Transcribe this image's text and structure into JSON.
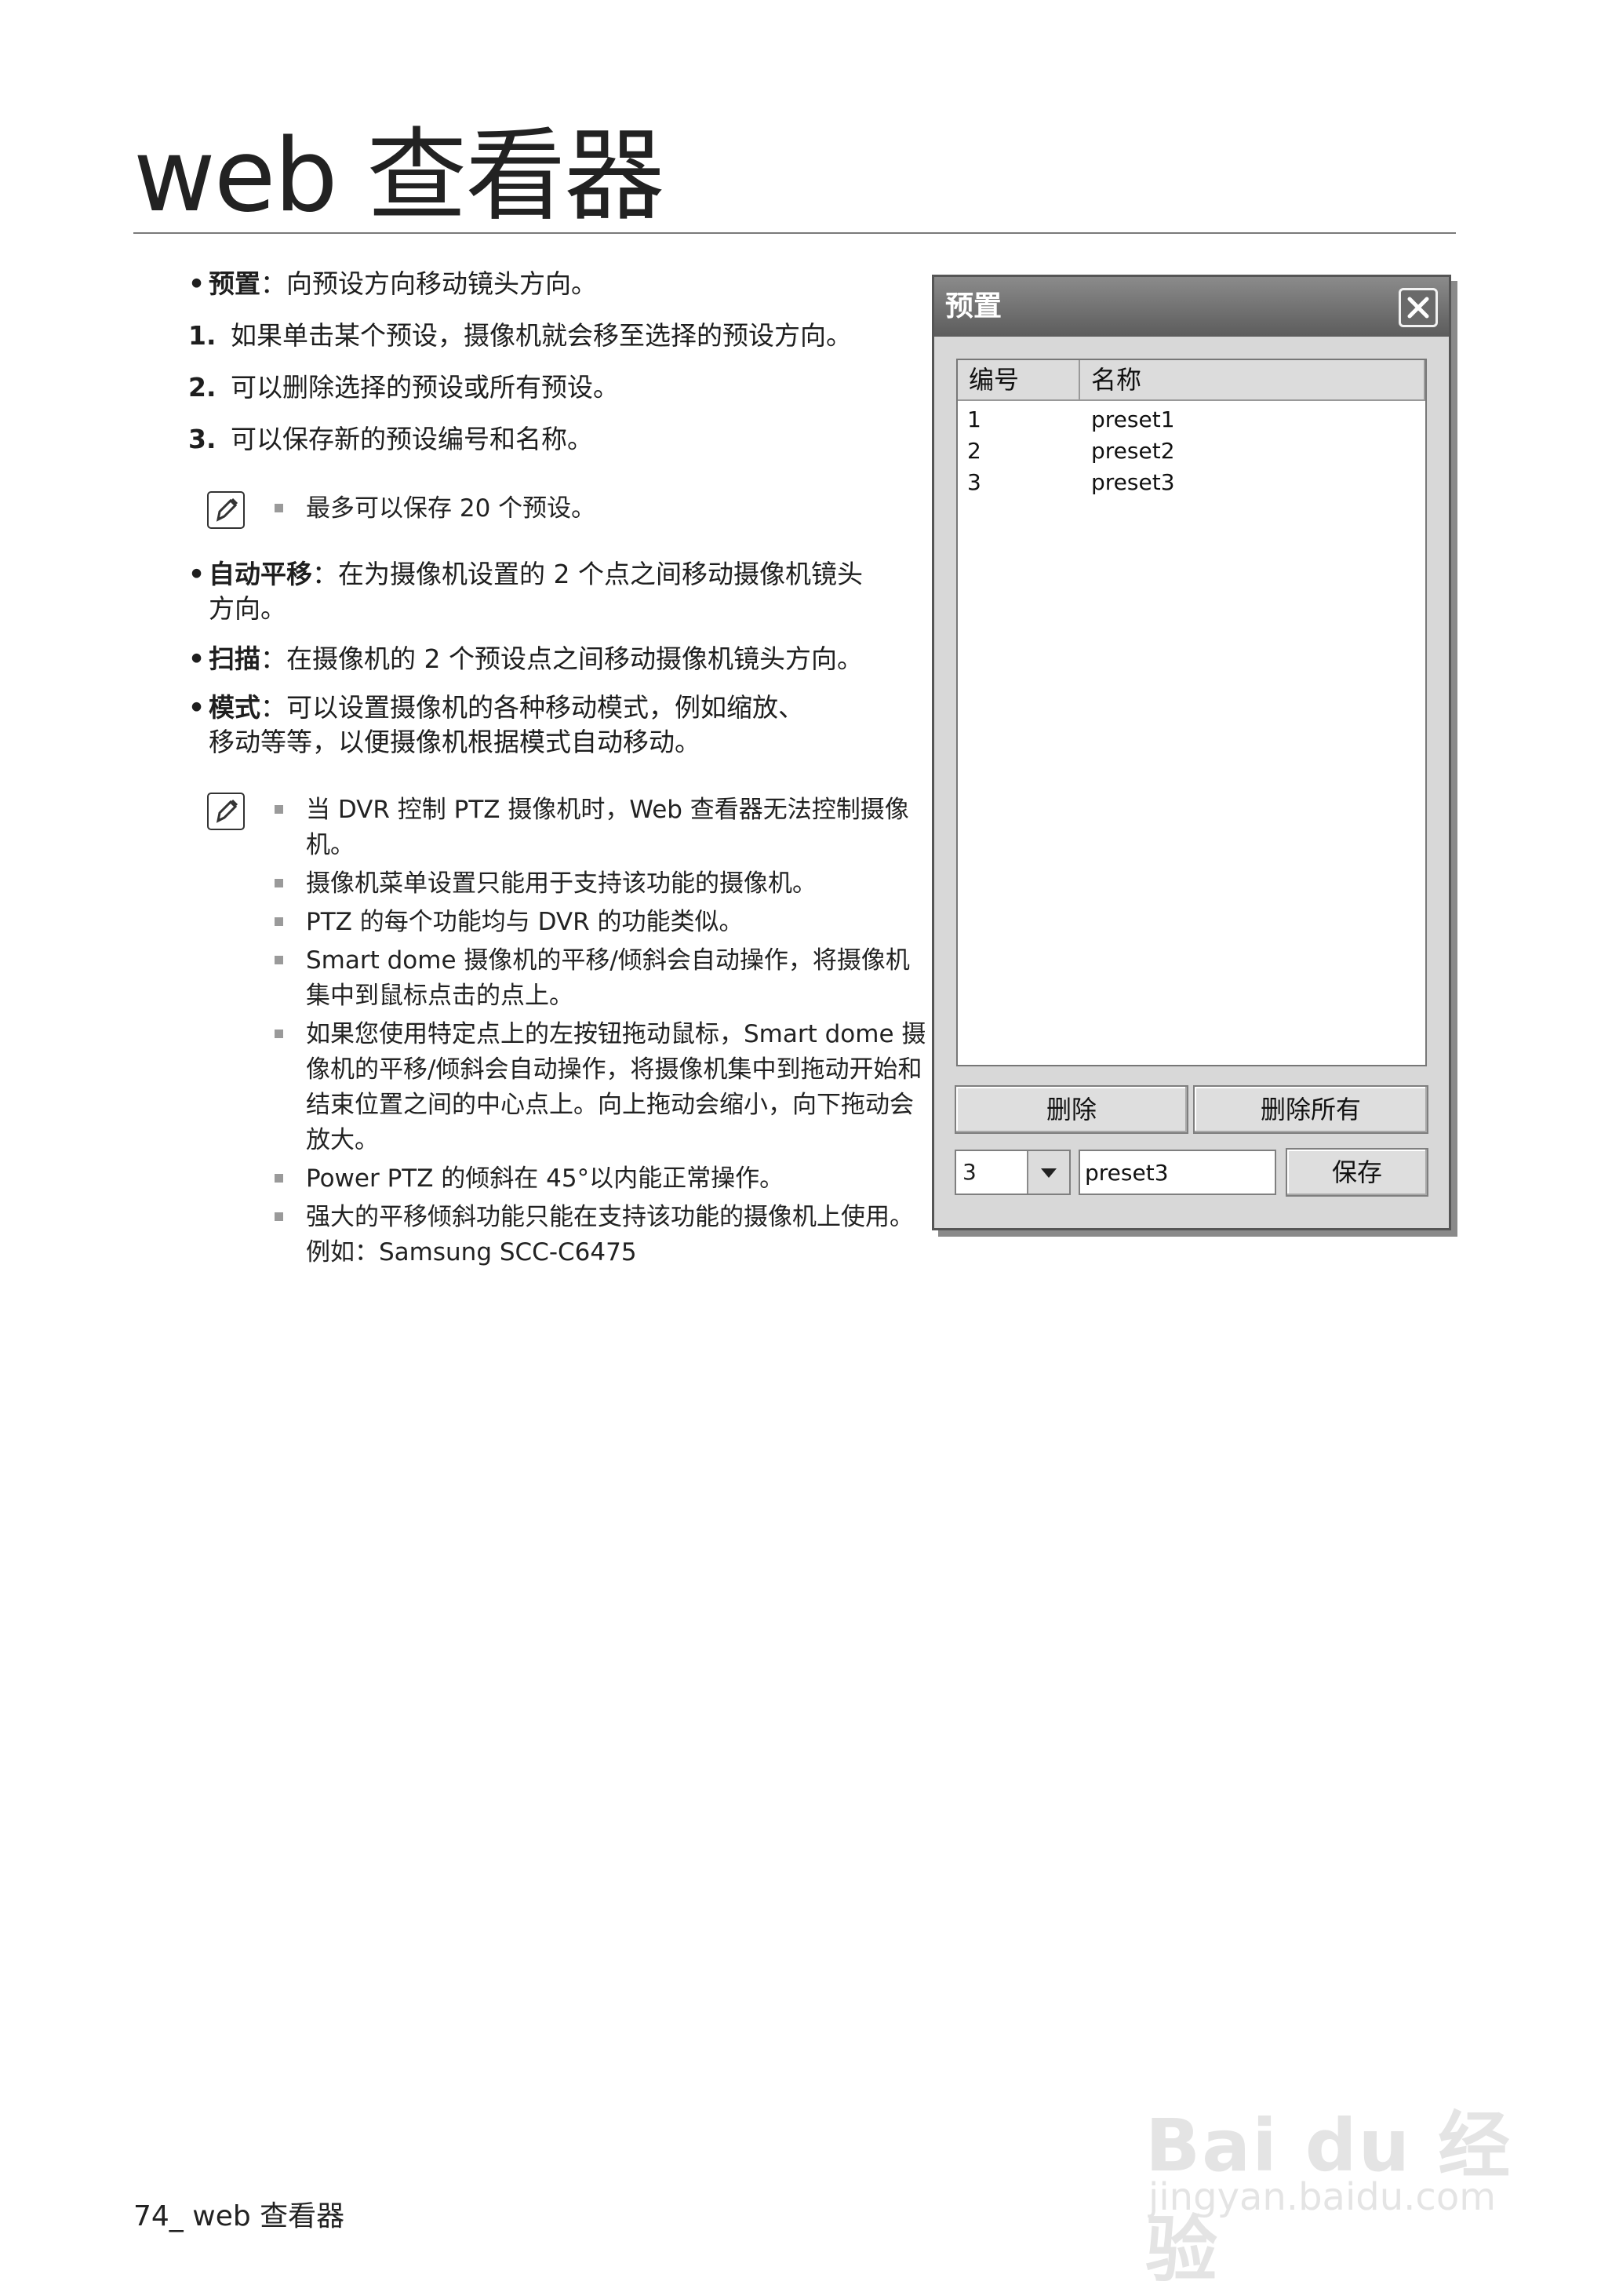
{
  "page": {
    "title": "web 查看器",
    "footer": "74_ web 查看器"
  },
  "left": {
    "preset_bullet": {
      "term": "预置",
      "text": "：向预设方向移动镜头方向。"
    },
    "steps": [
      {
        "num": "1.",
        "text": "如果单击某个预设，摄像机就会移至选择的预设方向。"
      },
      {
        "num": "2.",
        "text": "可以删除选择的预设或所有预设。"
      },
      {
        "num": "3.",
        "text": "可以保存新的预设编号和名称。"
      }
    ],
    "note1": [
      "最多可以保存 20 个预设。"
    ],
    "auto_pan": {
      "term": "自动平移",
      "text1": "：在为摄像机设置的 2 个点之间移动摄像机镜头",
      "text2": "方向。"
    },
    "scan": {
      "term": "扫描",
      "text": "：在摄像机的 2 个预设点之间移动摄像机镜头方向。"
    },
    "mode": {
      "term": "模式",
      "text1": "：可以设置摄像机的各种移动模式，例如缩放、",
      "text2": "移动等等，以便摄像机根据模式自动移动。"
    },
    "note2": [
      "当 DVR 控制 PTZ 摄像机时，Web 查看器无法控制摄像机。",
      "摄像机菜单设置只能用于支持该功能的摄像机。",
      "PTZ 的每个功能均与 DVR 的功能类似。",
      "Smart dome 摄像机的平移/倾斜会自动操作，将摄像机集中到鼠标点击的点上。",
      "如果您使用特定点上的左按钮拖动鼠标，Smart dome 摄像机的平移/倾斜会自动操作，将摄像机集中到拖动开始和结束位置之间的中心点上。向上拖动会缩小，向下拖动会放大。",
      "Power PTZ 的倾斜在 45°以内能正常操作。",
      "强大的平移倾斜功能只能在支持该功能的摄像机上使用。例如：Samsung SCC-C6475"
    ]
  },
  "dialog": {
    "title": "预置",
    "columns": {
      "no": "编号",
      "name": "名称"
    },
    "rows": [
      {
        "no": "1",
        "name": "preset1"
      },
      {
        "no": "2",
        "name": "preset2"
      },
      {
        "no": "3",
        "name": "preset3"
      }
    ],
    "delete_label": "删除",
    "delete_all_label": "删除所有",
    "combo_value": "3",
    "name_value": "preset3",
    "save_label": "保存"
  },
  "watermark": {
    "line1": "Bai du 经验",
    "line2": "jingyan.baidu.com"
  }
}
